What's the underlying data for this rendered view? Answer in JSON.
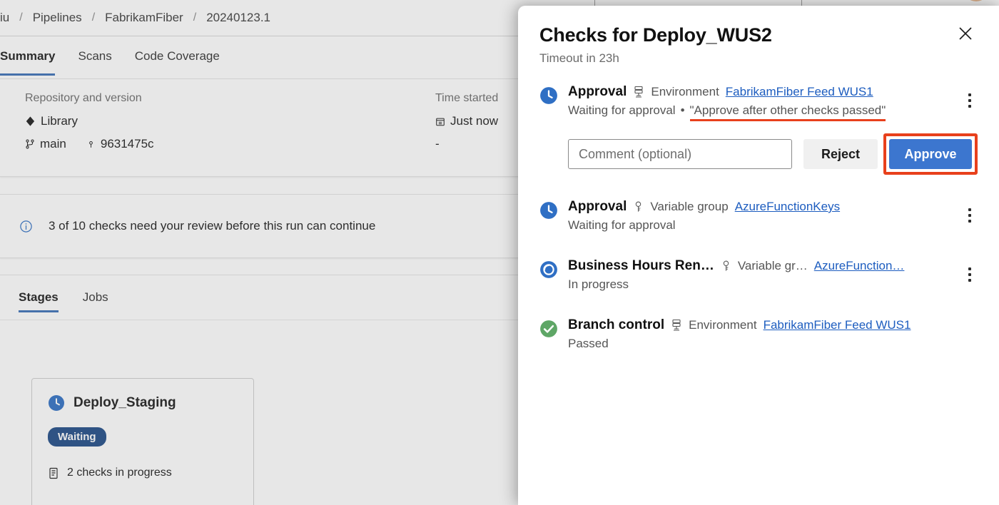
{
  "breadcrumb": {
    "items": [
      "iu",
      "Pipelines",
      "FabrikamFiber",
      "20240123.1"
    ],
    "separator": "/"
  },
  "tabs": [
    {
      "label": "Summary",
      "active": true
    },
    {
      "label": "Scans",
      "active": false
    },
    {
      "label": "Code Coverage",
      "active": false
    }
  ],
  "summary": {
    "repo_label": "Repository and version",
    "repo_name": "Library",
    "branch": "main",
    "commit": "9631475c",
    "time_started_label": "Time started",
    "time_started_value": "Just now",
    "elapsed_value": "-"
  },
  "info_banner": {
    "icon": "info-icon",
    "text": "3 of 10 checks need your review before this run can continue"
  },
  "stages_section": {
    "tabs": [
      {
        "label": "Stages",
        "active": true
      },
      {
        "label": "Jobs",
        "active": false
      }
    ],
    "stage_card": {
      "icon": "clock-icon",
      "name": "Deploy_Staging",
      "status_pill": "Waiting",
      "checks_icon": "checklist-icon",
      "checks_text": "2 checks in progress"
    }
  },
  "panel": {
    "title": "Checks for Deploy_WUS2",
    "subtitle": "Timeout in 23h",
    "close_icon": "close-icon",
    "checks": [
      {
        "icon": "clock-icon",
        "name": "Approval",
        "resource_icon": "environment-icon",
        "resource_type": "Environment",
        "resource_link": "FabrikamFiber Feed WUS1",
        "status": "Waiting for approval",
        "separator": "•",
        "note": "\"Approve after other checks passed\"",
        "note_underlined": true,
        "menu_icon": "kebab-menu-icon",
        "has_actions": true
      },
      {
        "icon": "clock-icon",
        "name": "Approval",
        "resource_icon": "variable-group-icon",
        "resource_type": "Variable group",
        "resource_link": "AzureFunctionKeys",
        "status": "Waiting for approval",
        "menu_icon": "kebab-menu-icon",
        "has_actions": false
      },
      {
        "icon": "in-progress-icon",
        "name": "Business Hours Ren…",
        "resource_icon": "variable-group-icon",
        "resource_type": "Variable gr…",
        "resource_link": "AzureFunction…",
        "status": "In progress",
        "menu_icon": "kebab-menu-icon",
        "has_actions": false
      },
      {
        "icon": "success-check-icon",
        "name": "Branch control",
        "resource_icon": "environment-icon",
        "resource_type": "Environment",
        "resource_link": "FabrikamFiber Feed WUS1",
        "status": "Passed",
        "menu_icon": null,
        "has_actions": false
      }
    ],
    "actions": {
      "comment_placeholder": "Comment (optional)",
      "comment_value": "",
      "reject_label": "Reject",
      "approve_label": "Approve"
    }
  },
  "colors": {
    "accent_blue": "#3c76cf",
    "link_blue": "#1c5cbf",
    "highlight_red": "#e8401c",
    "success_green": "#5ea666",
    "pill_navy": "#1f4b87",
    "tab_underline": "#3b6fb6"
  }
}
